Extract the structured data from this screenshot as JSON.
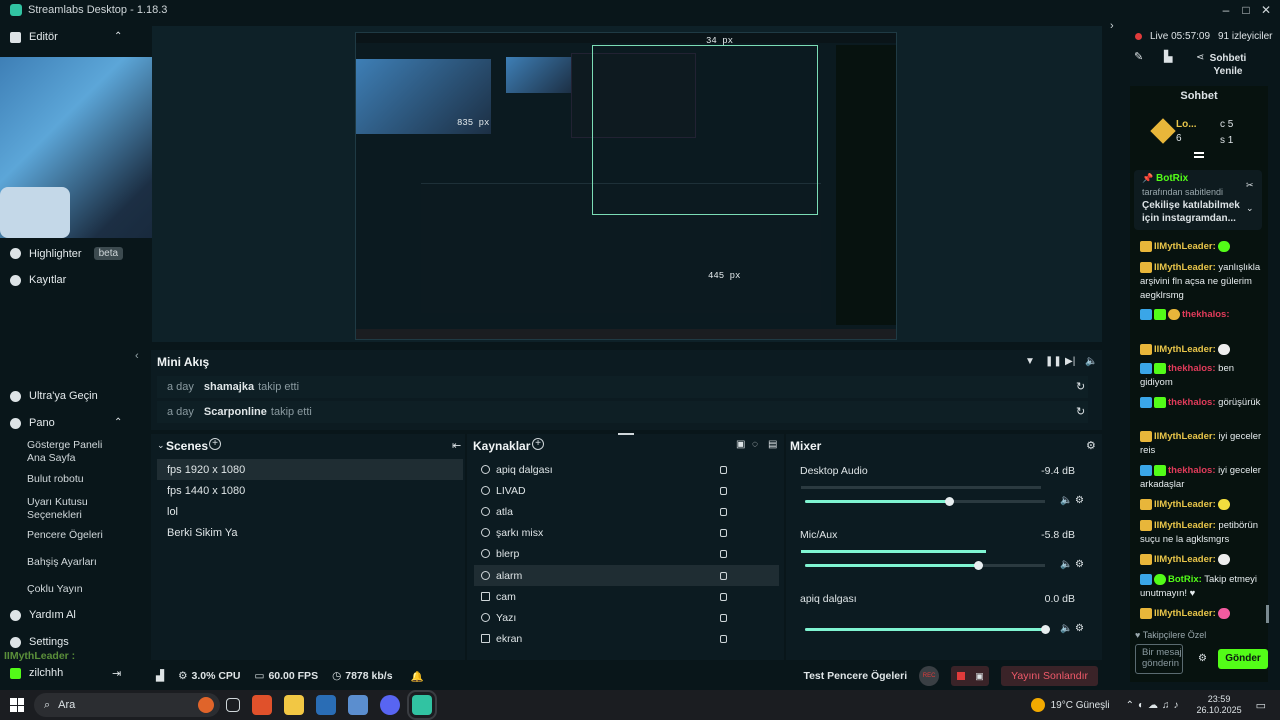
{
  "app": {
    "title": "Streamlabs Desktop - 1.18.3"
  },
  "sidebar": {
    "editor_label": "Editör",
    "items": [
      {
        "label": "Highlighter",
        "badge": "beta"
      },
      {
        "label": "Kayıtlar"
      }
    ],
    "ultra_label": "Ultra'ya Geçin",
    "dashboard_label": "Pano",
    "dashboard_items": [
      "Gösterge Paneli Ana Sayfa",
      "Bulut robotu",
      "Uyarı Kutusu Seçenekleri",
      "Pencere Ögeleri",
      "Bahşiş Ayarları",
      "Çoklu Yayın"
    ],
    "help_label": "Yardım Al",
    "settings_label": "Settings",
    "overlay_user": "IIMythLeader :",
    "account_name": "zilchhh"
  },
  "preview": {
    "dim_top": "34 px",
    "dim_left": "835 px",
    "dim_bottom": "445 px"
  },
  "mini_feed": {
    "title": "Mini Akış",
    "events": [
      {
        "time": "a day",
        "user": "shamajka",
        "action": "takip etti"
      },
      {
        "time": "a day",
        "user": "Scarponline",
        "action": "takip etti"
      }
    ]
  },
  "scenes": {
    "title": "Scenes",
    "items": [
      "fps 1920 x 1080",
      "fps 1440 x 1080",
      "lol",
      "Berki Sikim Ya"
    ]
  },
  "sources": {
    "title": "Kaynaklar",
    "items": [
      "apiq dalgası",
      "LIVAD",
      "atla",
      "şarkı misx",
      "blerp",
      "alarm",
      "cam",
      "Yazı",
      "ekran"
    ]
  },
  "mixer": {
    "title": "Mixer",
    "channels": [
      {
        "name": "Desktop Audio",
        "db": "-9.4 dB",
        "level": 0.6
      },
      {
        "name": "Mic/Aux",
        "db": "-5.8 dB",
        "level": 0.72
      },
      {
        "name": "apiq dalgası",
        "db": "0.0 dB",
        "level": 1.0
      }
    ]
  },
  "status": {
    "cpu": "3.0% CPU",
    "fps": "60.00 FPS",
    "bitrate": "7878 kb/s",
    "test_widgets": "Test Pencere Ögeleri",
    "rec": "REC",
    "end_stream": "Yayını Sonlandır"
  },
  "chat": {
    "live": "Live 05:57:09",
    "viewers": "91 izleyiciler",
    "refresh": "Sohbeti Yenile",
    "title": "Sohbet",
    "leader_name": "Lo...",
    "leader_count": "6",
    "stat_c": "c 5",
    "stat_s": "s 1",
    "pinned_user": "BotRix",
    "pinned_by": "tarafından sabitlendi",
    "pinned_text": "Çekilişe katılabilmek için instagramdan...",
    "messages": [
      {
        "user": "IIMythLeader:",
        "text": ""
      },
      {
        "user": "IIMythLeader:",
        "text": "yanlışlıkla arşivini fln açsa ne gülerim aegklrsmg"
      },
      {
        "user": "thekhalos:",
        "text": ""
      },
      {
        "user": "IIMythLeader:",
        "text": ""
      },
      {
        "user": "thekhalos:",
        "text": "ben gidiyom"
      },
      {
        "user": "thekhalos:",
        "text": "görüşürük"
      },
      {
        "user": "IIMythLeader:",
        "text": "iyi geceler reis"
      },
      {
        "user": "thekhalos:",
        "text": "iyi geceler arkadaşlar"
      },
      {
        "user": "IIMythLeader:",
        "text": ""
      },
      {
        "user": "IIMythLeader:",
        "text": "petibörün suçu ne la agklsmgrs"
      },
      {
        "user": "IIMythLeader:",
        "text": ""
      },
      {
        "user": "BotRix:",
        "text": "Takip etmeyi unutmayın! ♥"
      },
      {
        "user": "IIMythLeader:",
        "text": ""
      }
    ],
    "followers_only": "Takipçilere Özel",
    "input_placeholder": "Bir mesaj gönderin",
    "send": "Gönder"
  },
  "taskbar": {
    "search": "Ara",
    "weather": "19°C  Güneşli",
    "time": "23:59",
    "date": "26.10.2025"
  }
}
